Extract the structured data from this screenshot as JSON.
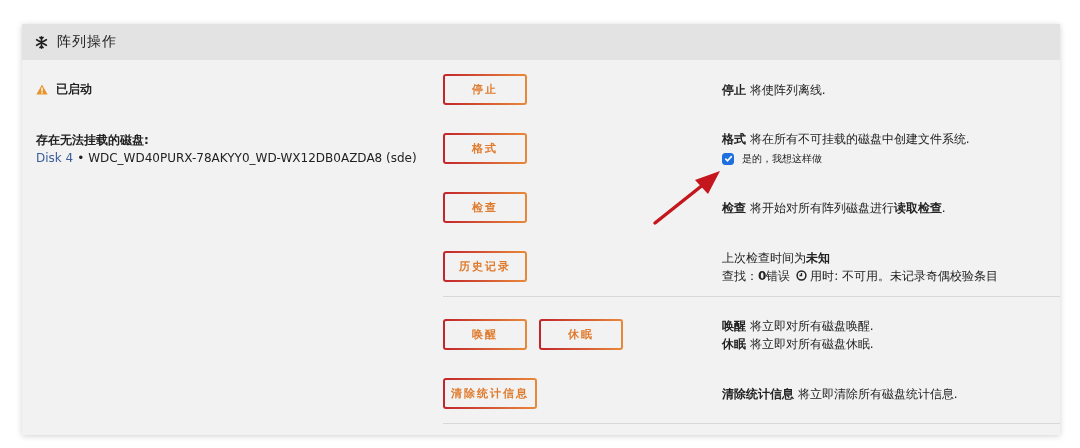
{
  "panel": {
    "title": "阵列操作"
  },
  "status": {
    "label": "已启动"
  },
  "unmountable": {
    "heading": "存在无法挂载的磁盘:",
    "disk_link": "Disk 4",
    "disk_detail": "• WDC_WD40PURX-78AKYY0_WD-WX12DB0AZDA8 (sde)"
  },
  "actions": [
    {
      "buttons": [
        "停止"
      ],
      "lines": [
        {
          "text": "**停止** 将使阵列离线."
        }
      ],
      "divider_after": false
    },
    {
      "buttons": [
        "格式"
      ],
      "lines": [
        {
          "text": "**格式** 将在所有不可挂载的磁盘中创建文件系统."
        }
      ],
      "confirm": {
        "label": "是的，我想这样做",
        "checked": true
      },
      "divider_after": false
    },
    {
      "buttons": [
        "检查"
      ],
      "lines": [
        {
          "text": "**检查** 将开始对所有阵列磁盘进行**读取检查**."
        }
      ],
      "divider_after": false
    },
    {
      "buttons": [
        "历史记录"
      ],
      "lines": [
        {
          "text": "上次检查时间为**未知**"
        },
        {
          "text": "查找：**0**错误",
          "after_clock": "用时: 不可用。未记录奇偶校验条目"
        }
      ],
      "divider_after": true
    },
    {
      "buttons": [
        "唤醒",
        "休眠"
      ],
      "lines": [
        {
          "text": "**唤醒** 将立即对所有磁盘唤醒."
        },
        {
          "text": "**休眠** 将立即对所有磁盘休眠."
        }
      ],
      "divider_after": false
    },
    {
      "buttons": [
        "清除统计信息"
      ],
      "lines": [
        {
          "text": "**清除统计信息** 将立即清除所有磁盘统计信息."
        }
      ],
      "divider_after": true
    }
  ]
}
